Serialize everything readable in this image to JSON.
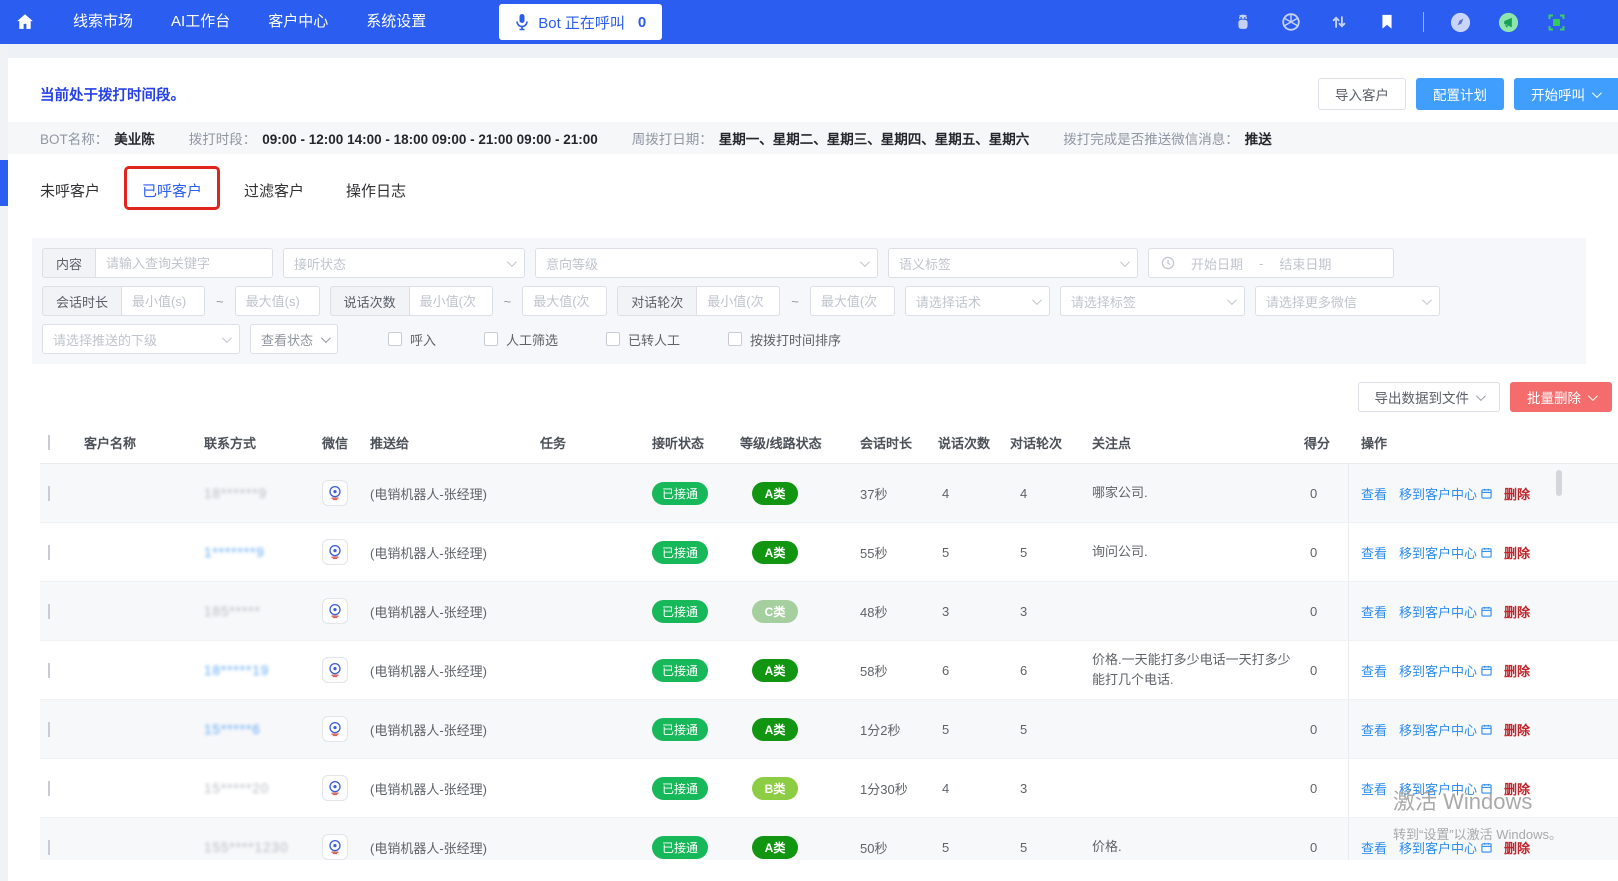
{
  "topnav": {
    "items": [
      "线索市场",
      "AI工作台",
      "客户中心",
      "系统设置"
    ],
    "bot_button": {
      "label": "Bot 正在呼叫",
      "count": "0"
    }
  },
  "header": {
    "status_text": "当前处于拨打时间段。",
    "buttons": {
      "import": "导入客户",
      "configure": "配置计划",
      "start_call": "开始呼叫"
    }
  },
  "bot_info": {
    "fields": [
      {
        "label": "BOT名称：",
        "value": "美业陈"
      },
      {
        "label": "拨打时段：",
        "value": "09:00 - 12:00 14:00 - 18:00 09:00 - 21:00 09:00 - 21:00"
      },
      {
        "label": "周拨打日期：",
        "value": "星期一、星期二、星期三、星期四、星期五、星期六"
      },
      {
        "label": "拨打完成是否推送微信消息：",
        "value": "推送"
      }
    ]
  },
  "tabs": [
    {
      "label": "未呼客户"
    },
    {
      "label": "已呼客户"
    },
    {
      "label": "过滤客户"
    },
    {
      "label": "操作日志"
    }
  ],
  "filters": {
    "content_label": "内容",
    "content_placeholder": "请输入查询关键字",
    "selects_row1": [
      "接听状态",
      "意向等级",
      "语义标签"
    ],
    "date_range": {
      "start": "开始日期",
      "sep": "-",
      "end": "结束日期"
    },
    "range_sep": "~",
    "row2": [
      {
        "label": "会话时长",
        "min": "最小值(s)",
        "max": "最大值(s)"
      },
      {
        "label": "说话次数",
        "min": "最小值(次",
        "max": "最大值(次"
      },
      {
        "label": "对话轮次",
        "min": "最小值(次",
        "max": "最大值(次"
      }
    ],
    "selects_row2": [
      "请选择话术",
      "请选择标签",
      "请选择更多微信"
    ],
    "selects_row3": [
      "请选择推送的下级",
      "查看状态"
    ],
    "checkboxes": [
      "呼入",
      "人工筛选",
      "已转人工",
      "按拨打时间排序"
    ]
  },
  "toolbar": {
    "export_label": "导出数据到文件",
    "batch_delete_label": "批量删除"
  },
  "table": {
    "columns": [
      "客户名称",
      "联系方式",
      "微信",
      "推送给",
      "任务",
      "接听状态",
      "等级/线路状态",
      "会话时长",
      "说话次数",
      "对话轮次",
      "关注点",
      "得分",
      "操作"
    ],
    "actions": {
      "view": "查看",
      "move": "移到客户中心",
      "delete": "删除"
    },
    "rows": [
      {
        "phone": "18******9",
        "phone_style": "phone-gray",
        "pushed_to": "(电销机器人-张经理)",
        "status": "已接通",
        "grade": "A类",
        "grade_type": "A",
        "duration": "37秒",
        "speak_count": "4",
        "turns": "4",
        "focus": "哪家公司.",
        "score": "0"
      },
      {
        "phone": "1*******9",
        "phone_style": "phone-blue",
        "pushed_to": "(电销机器人-张经理)",
        "status": "已接通",
        "grade": "A类",
        "grade_type": "A",
        "duration": "55秒",
        "speak_count": "5",
        "turns": "5",
        "focus": "询问公司.",
        "score": "0"
      },
      {
        "phone": "185*****",
        "phone_style": "phone-gray",
        "pushed_to": "(电销机器人-张经理)",
        "status": "已接通",
        "grade": "C类",
        "grade_type": "C",
        "duration": "48秒",
        "speak_count": "3",
        "turns": "3",
        "focus": "",
        "score": "0"
      },
      {
        "phone": "18*****19",
        "phone_style": "phone-blue",
        "pushed_to": "(电销机器人-张经理)",
        "status": "已接通",
        "grade": "A类",
        "grade_type": "A",
        "duration": "58秒",
        "speak_count": "6",
        "turns": "6",
        "focus": "价格.一天能打多少电话一天打多少能打几个电话.",
        "score": "0"
      },
      {
        "phone": "15*****6",
        "phone_style": "phone-blue",
        "pushed_to": "(电销机器人-张经理)",
        "status": "已接通",
        "grade": "A类",
        "grade_type": "A",
        "duration": "1分2秒",
        "speak_count": "5",
        "turns": "5",
        "focus": "",
        "score": "0"
      },
      {
        "phone": "15*****20",
        "phone_style": "phone-gray",
        "pushed_to": "(电销机器人-张经理)",
        "status": "已接通",
        "grade": "B类",
        "grade_type": "B",
        "duration": "1分30秒",
        "speak_count": "4",
        "turns": "3",
        "focus": "",
        "score": "0"
      },
      {
        "phone": "155****1230",
        "phone_style": "phone-gray",
        "pushed_to": "(电销机器人-张经理)",
        "status": "已接通",
        "grade": "A类",
        "grade_type": "A",
        "duration": "50秒",
        "speak_count": "5",
        "turns": "5",
        "focus": "价格.",
        "score": "0"
      }
    ]
  },
  "watermark": {
    "line1": "激活 Windows",
    "line2": "转到“设置”以激活 Windows。"
  }
}
